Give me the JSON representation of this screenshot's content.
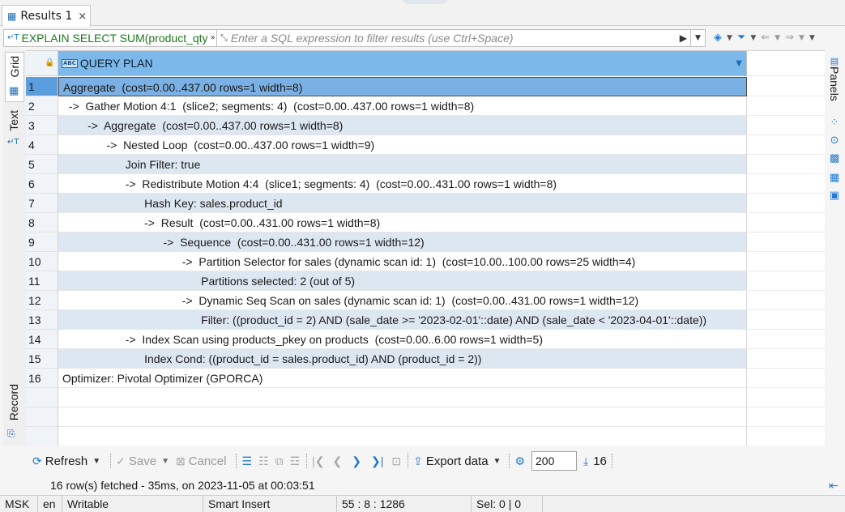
{
  "tab": {
    "label": "Results 1",
    "close": "×"
  },
  "filter": {
    "query": "EXPLAIN SELECT SUM(product_qty",
    "query_more": "»",
    "placeholder": "Enter a SQL expression to filter results (use Ctrl+Space)"
  },
  "left_tabs": {
    "grid": "Grid",
    "text": "Text",
    "record": "Record"
  },
  "grid": {
    "column": "QUERY PLAN",
    "rows": [
      {
        "n": "1",
        "text": "Aggregate  (cost=0.00..437.00 rows=1 width=8)"
      },
      {
        "n": "2",
        "text": "  ->  Gather Motion 4:1  (slice2; segments: 4)  (cost=0.00..437.00 rows=1 width=8)"
      },
      {
        "n": "3",
        "text": "        ->  Aggregate  (cost=0.00..437.00 rows=1 width=8)"
      },
      {
        "n": "4",
        "text": "              ->  Nested Loop  (cost=0.00..437.00 rows=1 width=9)"
      },
      {
        "n": "5",
        "text": "                    Join Filter: true"
      },
      {
        "n": "6",
        "text": "                    ->  Redistribute Motion 4:4  (slice1; segments: 4)  (cost=0.00..431.00 rows=1 width=8)"
      },
      {
        "n": "7",
        "text": "                          Hash Key: sales.product_id"
      },
      {
        "n": "8",
        "text": "                          ->  Result  (cost=0.00..431.00 rows=1 width=8)"
      },
      {
        "n": "9",
        "text": "                                ->  Sequence  (cost=0.00..431.00 rows=1 width=12)"
      },
      {
        "n": "10",
        "text": "                                      ->  Partition Selector for sales (dynamic scan id: 1)  (cost=10.00..100.00 rows=25 width=4)"
      },
      {
        "n": "11",
        "text": "                                            Partitions selected: 2 (out of 5)"
      },
      {
        "n": "12",
        "text": "                                      ->  Dynamic Seq Scan on sales (dynamic scan id: 1)  (cost=0.00..431.00 rows=1 width=12)"
      },
      {
        "n": "13",
        "text": "                                            Filter: ((product_id = 2) AND (sale_date >= '2023-02-01'::date) AND (sale_date < '2023-04-01'::date))"
      },
      {
        "n": "14",
        "text": "                    ->  Index Scan using products_pkey on products  (cost=0.00..6.00 rows=1 width=5)"
      },
      {
        "n": "15",
        "text": "                          Index Cond: ((product_id = sales.product_id) AND (product_id = 2))"
      },
      {
        "n": "16",
        "text": "Optimizer: Pivotal Optimizer (GPORCA)"
      }
    ]
  },
  "right_panel": {
    "label": "Panels"
  },
  "toolbar": {
    "refresh": "Refresh",
    "save": "Save",
    "cancel": "Cancel",
    "export": "Export data",
    "limit": "200",
    "count": "16"
  },
  "status": {
    "fetched": "16 row(s) fetched - 35ms, on 2023-11-05 at 00:03:51",
    "tz": "MSK",
    "lang": "en",
    "mode": "Writable",
    "insert": "Smart Insert",
    "pos": "55 : 8 : 1286",
    "sel": "Sel: 0 | 0"
  }
}
